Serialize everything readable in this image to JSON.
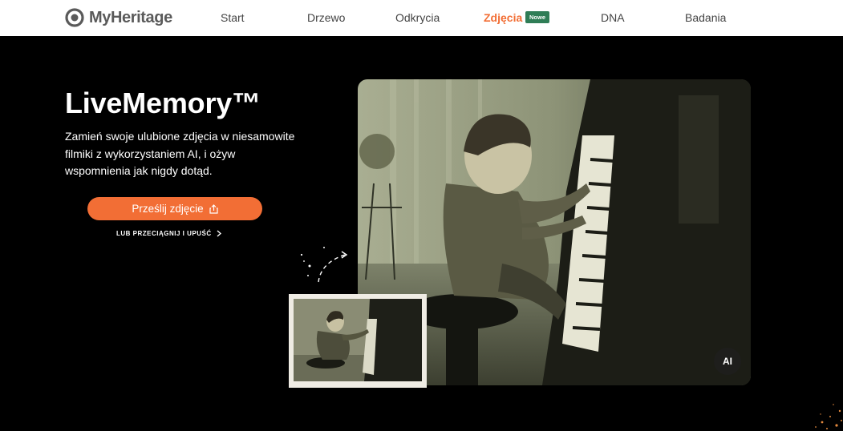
{
  "brand": {
    "name": "MyHeritage",
    "logo_icon": "myheritage-logo-icon"
  },
  "nav": {
    "items": [
      {
        "label": "Start",
        "active": false
      },
      {
        "label": "Drzewo",
        "active": false
      },
      {
        "label": "Odkrycia",
        "active": false
      },
      {
        "label": "Zdjęcia",
        "active": true
      },
      {
        "label": "DNA",
        "active": false
      },
      {
        "label": "Badania",
        "active": false
      }
    ],
    "badge": "Nowe"
  },
  "hero": {
    "title": "LiveMemory™",
    "description": "Zamień swoje ulubione zdjęcia w niesamowite filmiki z wykorzystaniem AI, i ożyw wspomnienia jak nigdy dotąd.",
    "upload_button": "Prześlij zdjęcie",
    "upload_icon": "share-upload-icon",
    "drag_link": "LUB PRZECIĄGNIJ I UPUŚĆ",
    "drag_icon": "chevron-right-icon",
    "ai_badge": "AI"
  },
  "colors": {
    "accent": "#f26e35",
    "badge": "#2f7d56",
    "background": "#000000",
    "nav_background": "#ffffff"
  }
}
